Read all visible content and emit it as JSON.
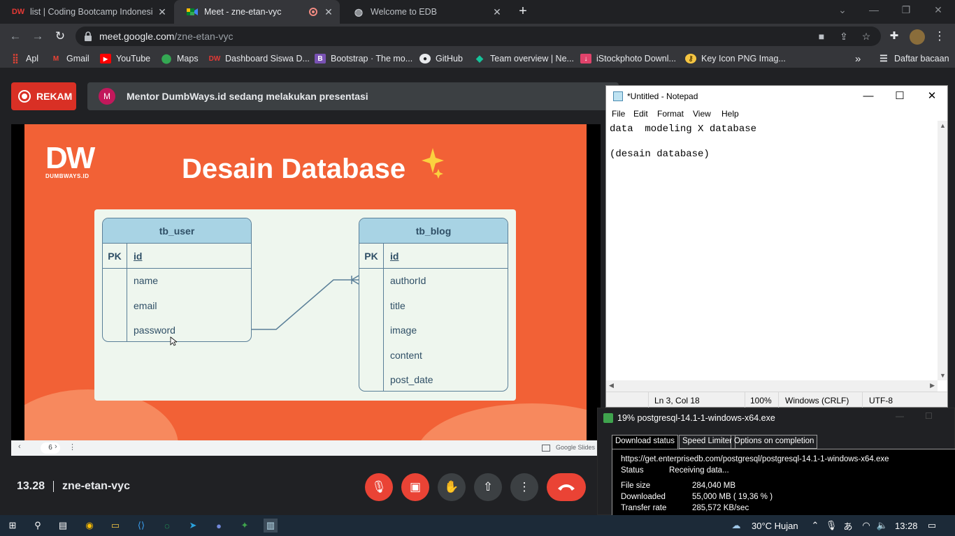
{
  "browser": {
    "tabs": [
      {
        "title": "list | Coding Bootcamp Indonesia",
        "favicon": "dumbways-icon",
        "active": false
      },
      {
        "title": "Meet - zne-etan-vyc",
        "favicon": "meet-icon",
        "active": true
      },
      {
        "title": "Welcome to EDB",
        "favicon": "globe-icon",
        "active": false
      }
    ],
    "url_host": "meet.google.com",
    "url_path": "/zne-etan-vyc",
    "bookmarks": [
      {
        "label": "Apl",
        "icon": "apps-grid-icon"
      },
      {
        "label": "Gmail",
        "icon": "gmail-icon"
      },
      {
        "label": "YouTube",
        "icon": "youtube-icon"
      },
      {
        "label": "Maps",
        "icon": "maps-icon"
      },
      {
        "label": "Dashboard Siswa D...",
        "icon": "dumbways-icon"
      },
      {
        "label": "Bootstrap · The mo...",
        "icon": "bootstrap-icon"
      },
      {
        "label": "GitHub",
        "icon": "github-icon"
      },
      {
        "label": "Team overview | Ne...",
        "icon": "netlify-icon"
      },
      {
        "label": "iStockphoto Downl...",
        "icon": "download-icon"
      },
      {
        "label": "Key Icon PNG Imag...",
        "icon": "key-icon"
      }
    ],
    "reading_list": "Daftar bacaan"
  },
  "meet": {
    "record_label": "REKAM",
    "presenter_initial": "M",
    "presenting_text": "Mentor DumbWays.id sedang melakukan presentasi",
    "time": "13.28",
    "meeting_code": "zne-etan-vyc",
    "slide_page": "6",
    "slides_brand": "Google Slides"
  },
  "slide": {
    "logo_text": "DW",
    "logo_sub": "DUMBWAYS.ID",
    "title": "Desain Database",
    "tables": [
      {
        "name": "tb_user",
        "pk_label": "PK",
        "pk": "id",
        "fields": [
          "name",
          "email",
          "password"
        ]
      },
      {
        "name": "tb_blog",
        "pk_label": "PK",
        "pk": "id",
        "fields": [
          "authorId",
          "title",
          "image",
          "content",
          "post_date"
        ]
      }
    ]
  },
  "notepad": {
    "title": "*Untitled - Notepad",
    "menu": [
      "File",
      "Edit",
      "Format",
      "View",
      "Help"
    ],
    "content": "data  modeling X database\n\n(desain database)",
    "status_pos": "Ln 3, Col 18",
    "zoom": "100%",
    "line_ending": "Windows (CRLF)",
    "encoding": "UTF-8"
  },
  "download": {
    "title": "19% postgresql-14.1-1-windows-x64.exe",
    "tabs": [
      "Download status",
      "Speed Limiter",
      "Options on completion"
    ],
    "url": "https://get.enterprisedb.com/postgresql/postgresql-14.1-1-windows-x64.exe",
    "status_label": "Status",
    "status_value": "Receiving data...",
    "filesize_label": "File size",
    "filesize_value": "284,040  MB",
    "downloaded_label": "Downloaded",
    "downloaded_value": "55,000  MB  ( 19,36 % )",
    "rate_label": "Transfer rate",
    "rate_value": "285,572  KB/sec"
  },
  "taskbar": {
    "weather": "30°C  Hujan",
    "clock": "13:28"
  },
  "colors": {
    "slide_bg": "#f26136",
    "meet_red": "#ea4335",
    "erd_header": "#a8d3e4"
  }
}
